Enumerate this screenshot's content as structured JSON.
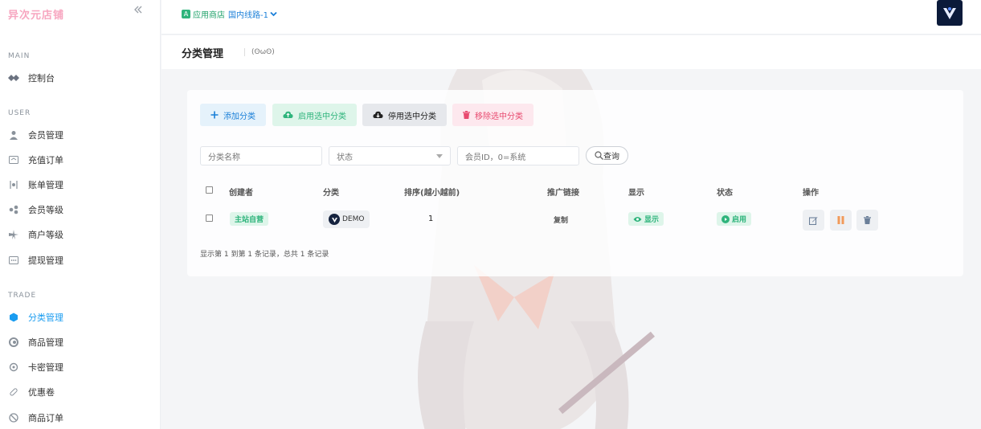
{
  "sidebar": {
    "brand": "异次元店铺",
    "sections": [
      {
        "title": "MAIN",
        "items": [
          {
            "label": "控制台",
            "icon": "dashboard-icon"
          }
        ]
      },
      {
        "title": "USER",
        "items": [
          {
            "label": "会员管理",
            "icon": "user-icon"
          },
          {
            "label": "充值订单",
            "icon": "recharge-icon"
          },
          {
            "label": "账单管理",
            "icon": "bill-icon"
          },
          {
            "label": "会员等级",
            "icon": "level-icon"
          },
          {
            "label": "商户等级",
            "icon": "merchant-level-icon"
          },
          {
            "label": "提现管理",
            "icon": "withdraw-icon"
          }
        ]
      },
      {
        "title": "TRADE",
        "items": [
          {
            "label": "分类管理",
            "icon": "category-icon",
            "active": true
          },
          {
            "label": "商品管理",
            "icon": "product-icon"
          },
          {
            "label": "卡密管理",
            "icon": "card-key-icon"
          },
          {
            "label": "优惠卷",
            "icon": "coupon-icon"
          },
          {
            "label": "商品订单",
            "icon": "order-icon"
          }
        ]
      }
    ]
  },
  "topbar": {
    "store_label": "应用商店",
    "route_label": "国内线路-1"
  },
  "page": {
    "title": "分类管理",
    "subtitle": "(ʘωʘ)"
  },
  "toolbar": {
    "add": "添加分类",
    "enable": "启用选中分类",
    "disable": "停用选中分类",
    "remove": "移除选中分类"
  },
  "filters": {
    "name_placeholder": "分类名称",
    "state_placeholder": "状态",
    "uid_placeholder": "会员ID，0=系统",
    "query": "查询"
  },
  "table": {
    "headers": [
      "创建者",
      "分类",
      "排序(越小越前)",
      "推广链接",
      "显示",
      "状态",
      "操作"
    ],
    "rows": [
      {
        "creator": "主站自营",
        "category": "DEMO",
        "sort": "1",
        "link": "复制",
        "display": "显示",
        "status": "启用"
      }
    ],
    "footer": "显示第 1 到第 1 条记录，总共 1 条记录"
  },
  "colors": {
    "accent": "#1a9cf0",
    "green": "#2fb47c",
    "red": "#e84a6f",
    "orange": "#f19a5a",
    "brand": "#f7a6c0"
  }
}
